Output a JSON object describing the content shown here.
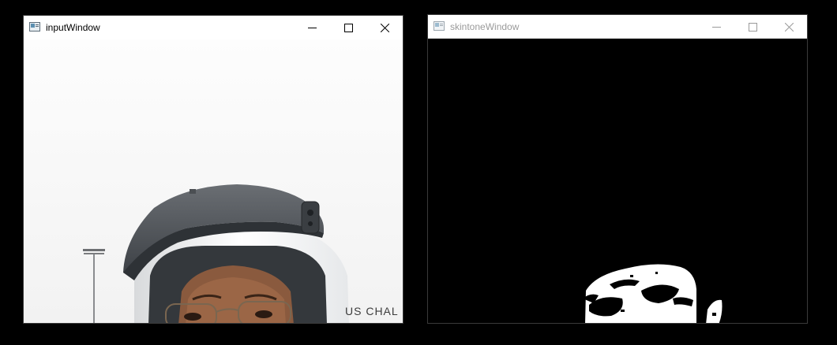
{
  "windows": [
    {
      "title": "inputWindow",
      "active": true,
      "controls": [
        "minimize-icon",
        "maximize-icon",
        "close-icon"
      ],
      "photo_text": "US CHAL"
    },
    {
      "title": "skintoneWindow",
      "active": false,
      "controls": [
        "minimize-icon",
        "maximize-icon",
        "close-icon"
      ]
    }
  ],
  "colors": {
    "desktop": "#000000",
    "titlebar": "#ffffff",
    "active_title": "#000000",
    "inactive_title": "#9a9a9a",
    "mask_background": "#000000",
    "mask_foreground": "#ffffff"
  }
}
